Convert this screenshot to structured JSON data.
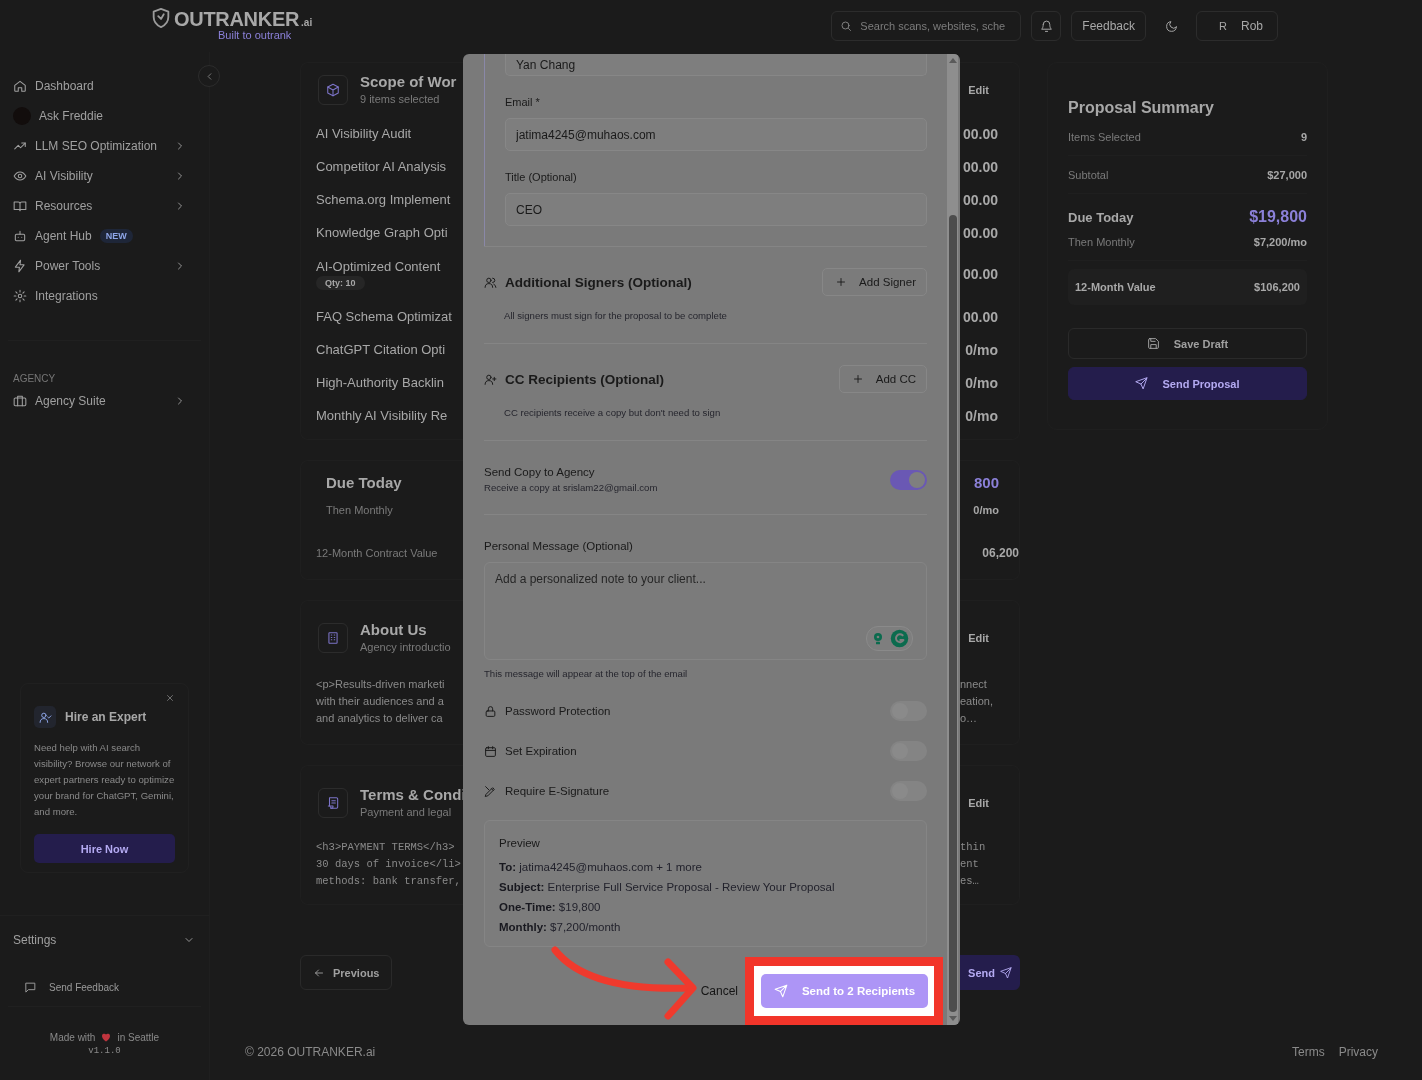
{
  "header": {
    "logo": {
      "name": "OUTRANKER",
      "suffix": ".ai",
      "tagline": "Built to outrank"
    },
    "search": {
      "placeholder": "Search scans, websites, sche"
    },
    "feedback": "Feedback",
    "user": {
      "initial": "R",
      "name": "Rob"
    }
  },
  "sidebar": {
    "items": [
      {
        "label": "Dashboard",
        "has_submenu": false
      },
      {
        "label": "Ask Freddie",
        "has_submenu": false
      },
      {
        "label": "LLM SEO Optimization",
        "has_submenu": true
      },
      {
        "label": "AI Visibility",
        "has_submenu": true
      },
      {
        "label": "Resources",
        "has_submenu": true
      },
      {
        "label": "Agent Hub",
        "has_submenu": false,
        "badge": "NEW"
      },
      {
        "label": "Power Tools",
        "has_submenu": true
      },
      {
        "label": "Integrations",
        "has_submenu": false
      }
    ],
    "section_label": "AGENCY",
    "agency_items": [
      {
        "label": "Agency Suite",
        "has_submenu": true
      }
    ],
    "promo": {
      "title": "Hire an Expert",
      "text": "Need help with AI search visibility? Browse our network of expert partners ready to optimize your brand for ChatGPT, Gemini, and more.",
      "button": "Hire Now"
    },
    "settings": "Settings",
    "send_feedback": "Send Feedback",
    "made_with": "Made with",
    "made_in": "in Seattle",
    "version": "v1.1.0"
  },
  "scope": {
    "title": "Scope of Wor",
    "subtitle": "9 items selected",
    "edit": "Edit",
    "items": [
      {
        "name": "AI Visibility Audit",
        "price": "00.00"
      },
      {
        "name": "Competitor AI Analysis",
        "price": "00.00"
      },
      {
        "name": "Schema.org Implement",
        "price": "00.00"
      },
      {
        "name": "Knowledge Graph Opti",
        "price": "00.00"
      },
      {
        "name": "AI-Optimized Content",
        "qty": "Qty: 10",
        "price": "00.00"
      },
      {
        "name": "FAQ Schema Optimizat",
        "price": "00.00"
      },
      {
        "name": "ChatGPT Citation Opti",
        "price": "0/mo"
      },
      {
        "name": "High-Authority Backlin",
        "price": "0/mo"
      },
      {
        "name": "Monthly AI Visibility Re",
        "price": "0/mo"
      }
    ]
  },
  "totals": {
    "due_label": "Due Today",
    "due_value": "800",
    "monthly_label": "Then Monthly",
    "monthly_value": "0/mo",
    "contract_label": "12-Month Contract Value",
    "contract_value": "06,200"
  },
  "about": {
    "title": "About Us",
    "subtitle": "Agency introductio",
    "edit": "Edit",
    "left_lines": [
      "<p>Results-driven marketi",
      "with their audiences and a",
      "and analytics to deliver ca"
    ],
    "right_lines": [
      "nnect",
      "eation,",
      "o…"
    ]
  },
  "terms": {
    "title": "Terms & Condi",
    "subtitle": "Payment and legal",
    "edit": "Edit",
    "left_lines": [
      "<h3>PAYMENT TERMS</h3>",
      "30 days of invoice</li>",
      "methods: bank transfer,"
    ],
    "right_lines": [
      "thin",
      "ent",
      "es…"
    ]
  },
  "nav": {
    "previous": "Previous",
    "send": "Send"
  },
  "footer": {
    "copyright": "© 2026 OUTRANKER.ai",
    "links": [
      "Terms",
      "Privacy"
    ]
  },
  "summary": {
    "title": "Proposal Summary",
    "rows": [
      {
        "label": "Items Selected",
        "value": "9"
      },
      {
        "label": "Subtotal",
        "value": "$27,000"
      }
    ],
    "due_label": "Due Today",
    "due_value": "$19,800",
    "monthly_label": "Then Monthly",
    "monthly_value": "$7,200/mo",
    "year_label": "12-Month Value",
    "year_value": "$106,200",
    "save": "Save Draft",
    "send": "Send Proposal"
  },
  "modal": {
    "signer": {
      "name_value": "Yan Chang",
      "email_label": "Email *",
      "email_value": "jatima4245@muhaos.com",
      "title_label": "Title (Optional)",
      "title_value": "CEO"
    },
    "sections": [
      {
        "title": "Additional Signers (Optional)",
        "button": "Add Signer",
        "hint": "All signers must sign for the proposal to be complete"
      },
      {
        "title": "CC Recipients (Optional)",
        "button": "Add CC",
        "hint": "CC recipients receive a copy but don't need to sign"
      }
    ],
    "agency_copy": {
      "label": "Send Copy to Agency",
      "sublabel": "Receive a copy at srislam22@gmail.com",
      "on": true
    },
    "message": {
      "label": "Personal Message (Optional)",
      "placeholder": "Add a personalized note to your client...",
      "hint": "This message will appear at the top of the email"
    },
    "options": [
      {
        "label": "Password Protection",
        "on": false
      },
      {
        "label": "Set Expiration",
        "on": false
      },
      {
        "label": "Require E-Signature",
        "on": false
      }
    ],
    "preview": {
      "title": "Preview",
      "lines": [
        "**To:** jatima4245@muhaos.com + 1 more",
        "**Subject:** Enterprise Full Service Proposal - Review Your Proposal",
        "**One-Time:** $19,800",
        "**Monthly:** $7,200/month"
      ]
    },
    "cancel": "Cancel",
    "send": "Send to 2 Recipients"
  }
}
